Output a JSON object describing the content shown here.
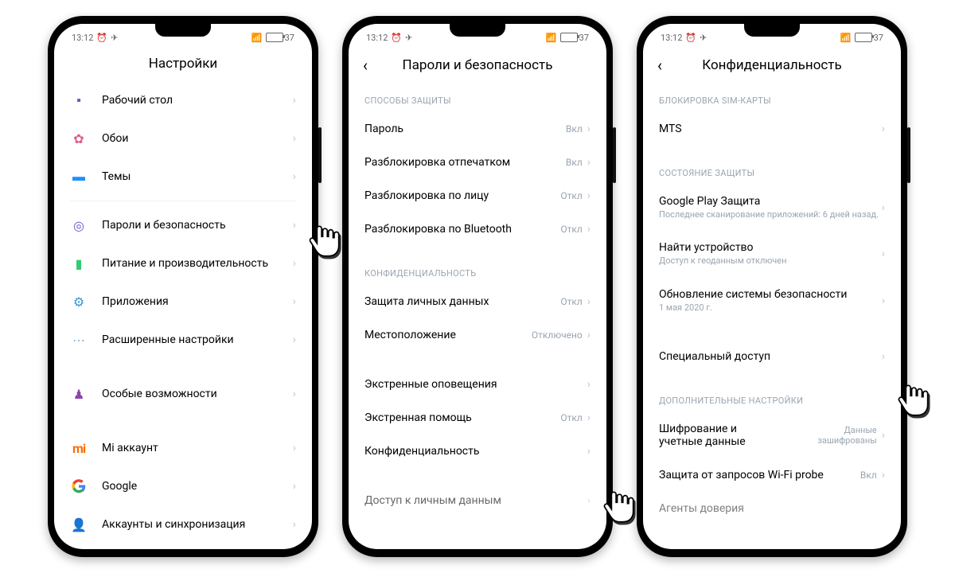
{
  "status": {
    "time": "13:12",
    "battery": "37"
  },
  "phone1": {
    "title": "Настройки",
    "items": [
      {
        "label": "Рабочий стол"
      },
      {
        "label": "Обои"
      },
      {
        "label": "Темы"
      },
      {
        "label": "Пароли и безопасность"
      },
      {
        "label": "Питание и производительность"
      },
      {
        "label": "Приложения"
      },
      {
        "label": "Расширенные настройки"
      },
      {
        "label": "Особые возможности"
      },
      {
        "label": "Mi аккаунт"
      },
      {
        "label": "Google"
      },
      {
        "label": "Аккаунты и синхронизация"
      }
    ]
  },
  "phone2": {
    "title": "Пароли и безопасность",
    "sec1": "СПОСОБЫ ЗАЩИТЫ",
    "sec2": "КОНФИДЕНЦИАЛЬНОСТЬ",
    "items": [
      {
        "label": "Пароль",
        "value": "Вкл"
      },
      {
        "label": "Разблокировка отпечатком",
        "value": "Вкл"
      },
      {
        "label": "Разблокировка по лицу",
        "value": "Откл"
      },
      {
        "label": "Разблокировка по Bluetooth",
        "value": "Откл"
      },
      {
        "label": "Защита личных данных",
        "value": "Откл"
      },
      {
        "label": "Местоположение",
        "value": "Отключено"
      },
      {
        "label": "Экстренные оповещения",
        "value": ""
      },
      {
        "label": "Экстренная помощь",
        "value": "Откл"
      },
      {
        "label": "Конфиденциальность",
        "value": ""
      },
      {
        "label": "Доступ к личным данным",
        "value": ""
      }
    ]
  },
  "phone3": {
    "title": "Конфиденциальность",
    "sec1": "БЛОКИРОВКА SIM-КАРТЫ",
    "sec2": "СОСТОЯНИЕ ЗАЩИТЫ",
    "sec3": "ДОПОЛНИТЕЛЬНЫЕ НАСТРОЙКИ",
    "items": {
      "mts": {
        "label": "MTS"
      },
      "play": {
        "label": "Google Play Защита",
        "sub": "Последнее сканирование приложений: 6 дней назад."
      },
      "find": {
        "label": "Найти устройство",
        "sub": "Доступ к геоданным отключен"
      },
      "upd": {
        "label": "Обновление системы безопасности",
        "sub": "1 мая 2020 г."
      },
      "spec": {
        "label": "Специальный доступ"
      },
      "enc": {
        "label1": "Шифрование и",
        "label2": "учетные данные",
        "val1": "Данные",
        "val2": "зашифрованы"
      },
      "wifi": {
        "label": "Защита от запросов Wi-Fi probe",
        "value": "Вкл"
      },
      "agents": {
        "label": "Агенты доверия"
      }
    }
  }
}
